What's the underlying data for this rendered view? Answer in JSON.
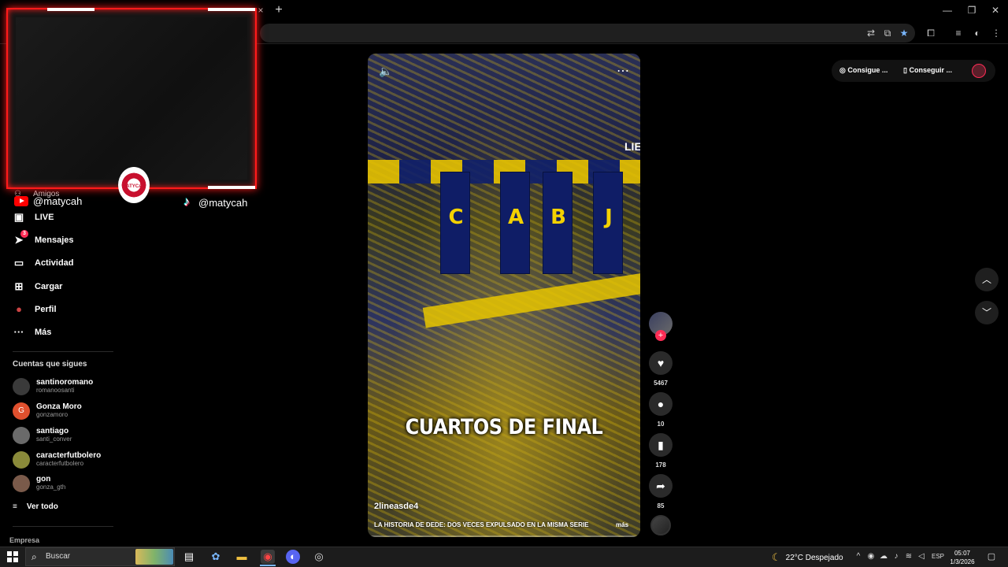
{
  "browser": {
    "tab_close_glyph": "×",
    "new_tab_glyph": "+",
    "window_buttons": {
      "minimize": "—",
      "restore": "❐",
      "close": "✕"
    }
  },
  "overlay": {
    "youtube_handle": "@matycah",
    "tiktok_handle": "@matycah",
    "logo_text": "MATYCAH"
  },
  "sidebar": {
    "amigos_label": "Amigos",
    "items": [
      {
        "label": "LIVE",
        "icon": "tv-icon",
        "glyph": "▣"
      },
      {
        "label": "Mensajes",
        "icon": "send-icon",
        "glyph": "➤",
        "badge": "3"
      },
      {
        "label": "Actividad",
        "icon": "inbox-icon",
        "glyph": "▭"
      },
      {
        "label": "Cargar",
        "icon": "upload-icon",
        "glyph": "⊞"
      },
      {
        "label": "Perfil",
        "icon": "profile-icon",
        "glyph": "●"
      },
      {
        "label": "Más",
        "icon": "more-icon",
        "glyph": "···"
      }
    ],
    "following_title": "Cuentas que sigues",
    "following": [
      {
        "name": "santinoromano",
        "user": "romanoosanti",
        "initial": "",
        "color": "#3a3a3a"
      },
      {
        "name": "Gonza Moro",
        "user": "gonzamoro",
        "initial": "G",
        "color": "#e0502e"
      },
      {
        "name": "santiago",
        "user": "santi_conver",
        "initial": "",
        "color": "#6a6a6a"
      },
      {
        "name": "caracterfutbolero",
        "user": "caracterfutbolero",
        "initial": "",
        "color": "#8a8a3a"
      },
      {
        "name": "gon",
        "user": "gonza_gth",
        "initial": "",
        "color": "#7a5a4a"
      }
    ],
    "see_all": "Ver todo",
    "footer": "Empresa"
  },
  "video": {
    "corner_text": "LIE",
    "flag_letters": [
      "C",
      "A",
      "B",
      "J"
    ],
    "caption": "CUARTOS DE FINAL",
    "author": "2lineasde4",
    "description": "LA HISTORIA DE DEDE: DOS VECES EXPULSADO EN LA MISMA SERIE",
    "more": "más"
  },
  "actions": {
    "likes": "5467",
    "comments": "10",
    "saves": "178",
    "shares": "85"
  },
  "top_right": {
    "get_coins": "Consigue ...",
    "get_app": "Conseguir ..."
  },
  "taskbar": {
    "search_placeholder": "Buscar",
    "weather": "22°C  Despejado",
    "lang": "ESP",
    "time": "05:07",
    "date": "1/3/2026"
  }
}
